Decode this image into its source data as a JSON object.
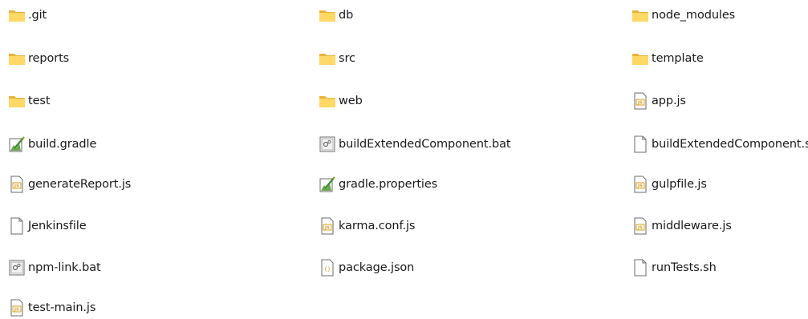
{
  "items": [
    {
      "name": ".git",
      "type": "folder"
    },
    {
      "name": "db",
      "type": "folder"
    },
    {
      "name": "node_modules",
      "type": "folder"
    },
    {
      "name": "reports",
      "type": "folder"
    },
    {
      "name": "src",
      "type": "folder"
    },
    {
      "name": "template",
      "type": "folder"
    },
    {
      "name": "test",
      "type": "folder"
    },
    {
      "name": "web",
      "type": "folder"
    },
    {
      "name": "app.js",
      "type": "js-file"
    },
    {
      "name": "build.gradle",
      "type": "gradle-file"
    },
    {
      "name": "buildExtendedComponent.bat",
      "type": "bat-file"
    },
    {
      "name": "buildExtendedComponent.sh",
      "type": "generic-file"
    },
    {
      "name": "generateReport.js",
      "type": "js-file"
    },
    {
      "name": "gradle.properties",
      "type": "gradle-file"
    },
    {
      "name": "gulpfile.js",
      "type": "js-file"
    },
    {
      "name": "Jenkinsfile",
      "type": "generic-file"
    },
    {
      "name": "karma.conf.js",
      "type": "js-file"
    },
    {
      "name": "middleware.js",
      "type": "js-file"
    },
    {
      "name": "npm-link.bat",
      "type": "bat-file"
    },
    {
      "name": "package.json",
      "type": "json-file"
    },
    {
      "name": "runTests.sh",
      "type": "generic-file"
    },
    {
      "name": "test-main.js",
      "type": "js-file"
    }
  ],
  "colors": {
    "folder_body": "#f7c34b",
    "folder_front": "#ffd866",
    "folder_edge": "#e0a52a",
    "js_badge": "#d9a020",
    "file_outline": "#6b6b6b"
  }
}
